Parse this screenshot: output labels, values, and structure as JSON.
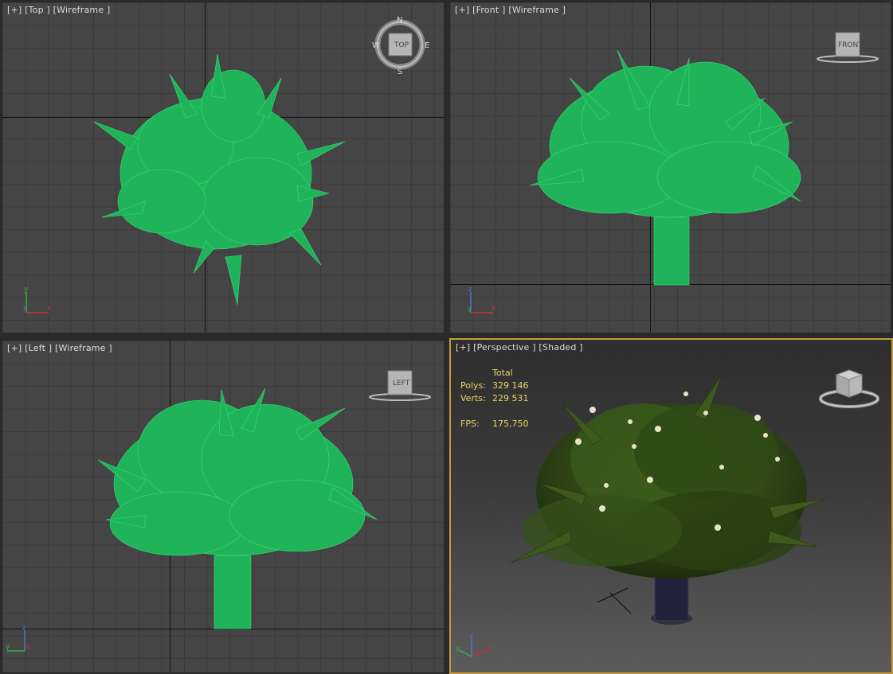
{
  "viewports": {
    "top": {
      "plus": "[+]",
      "view": "[Top ]",
      "mode": "[Wireframe ]"
    },
    "front": {
      "plus": "[+]",
      "view": "[Front ]",
      "mode": "[Wireframe ]"
    },
    "left": {
      "plus": "[+]",
      "view": "[Left ]",
      "mode": "[Wireframe ]"
    },
    "perspective": {
      "plus": "[+]",
      "view": "[Perspective ]",
      "mode": "[Shaded ]"
    }
  },
  "viewcube": {
    "top_face": "TOP",
    "front_face": "FRONT",
    "left_face": "LEFT",
    "compass": {
      "n": "N",
      "s": "S",
      "e": "E",
      "w": "W"
    }
  },
  "stats": {
    "header": "Total",
    "polys_label": "Polys:",
    "polys_value": "329 146",
    "verts_label": "Verts:",
    "verts_value": "229 531",
    "fps_label": "FPS:",
    "fps_value": "175,750"
  },
  "axes": {
    "top": {
      "up": "y",
      "right": "x",
      "depth": "z"
    },
    "front": {
      "up": "z",
      "right": "x",
      "depth": "y"
    },
    "left": {
      "up": "z",
      "right": "y",
      "depth": "x"
    },
    "perspective": {
      "up": "z",
      "right": "x",
      "depth": "y"
    }
  },
  "colors": {
    "wireframe": "#1fb35a",
    "wire_edge": "#3ddc7a",
    "active_border": "#c49a3c",
    "stats_text": "#e6d36a"
  }
}
